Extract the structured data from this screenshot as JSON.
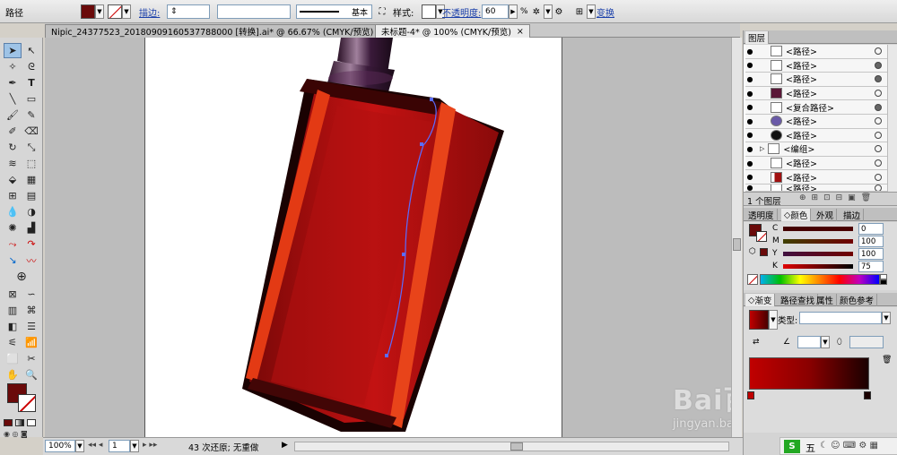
{
  "control_bar": {
    "object_type": "路径",
    "stroke_label": "描边:",
    "line_style": "基本",
    "style_label": "样式:",
    "opacity_label": "不透明度:",
    "opacity_value": "60",
    "percent": "%",
    "transform_label": "变换"
  },
  "tabs": [
    {
      "label": "Nipic_24377523_20180909160537788000 [转换].ai* @ 66.67% (CMYK/预览)"
    },
    {
      "label": "未标题-4* @ 100% (CMYK/预览)"
    }
  ],
  "close_glyph": "×",
  "status": {
    "zoom": "100%",
    "page": "1",
    "undo_text": "43 次还原; 无重做"
  },
  "layers_panel": {
    "tab": "图层",
    "rows": [
      {
        "name": "<路径>"
      },
      {
        "name": "<路径>"
      },
      {
        "name": "<路径>"
      },
      {
        "name": "<路径>"
      },
      {
        "name": "<复合路径>"
      },
      {
        "name": "<路径>"
      },
      {
        "name": "<路径>"
      },
      {
        "name": "<编组>"
      },
      {
        "name": "<路径>"
      },
      {
        "name": "<路径>"
      },
      {
        "name": "<路径>"
      }
    ],
    "footer": "1 个图层"
  },
  "color_panel": {
    "tabs": [
      "透明度",
      "颜色",
      "外观",
      "描边"
    ],
    "channels": [
      {
        "label": "C",
        "value": "0"
      },
      {
        "label": "M",
        "value": "100"
      },
      {
        "label": "Y",
        "value": "100"
      },
      {
        "label": "K",
        "value": "75"
      }
    ]
  },
  "gradient_panel": {
    "tabs": [
      "渐变",
      "路径查找",
      "属性",
      "颜色参考"
    ],
    "type_label": "类型:"
  },
  "watermark": {
    "main": "Bai百经验",
    "url": "jingyan.baidu.com"
  },
  "taskbar": {
    "ime": "五"
  },
  "colors": {
    "fill": "#6a0a0a",
    "bottle": "#b01010",
    "cap": "#3a1a3a"
  }
}
